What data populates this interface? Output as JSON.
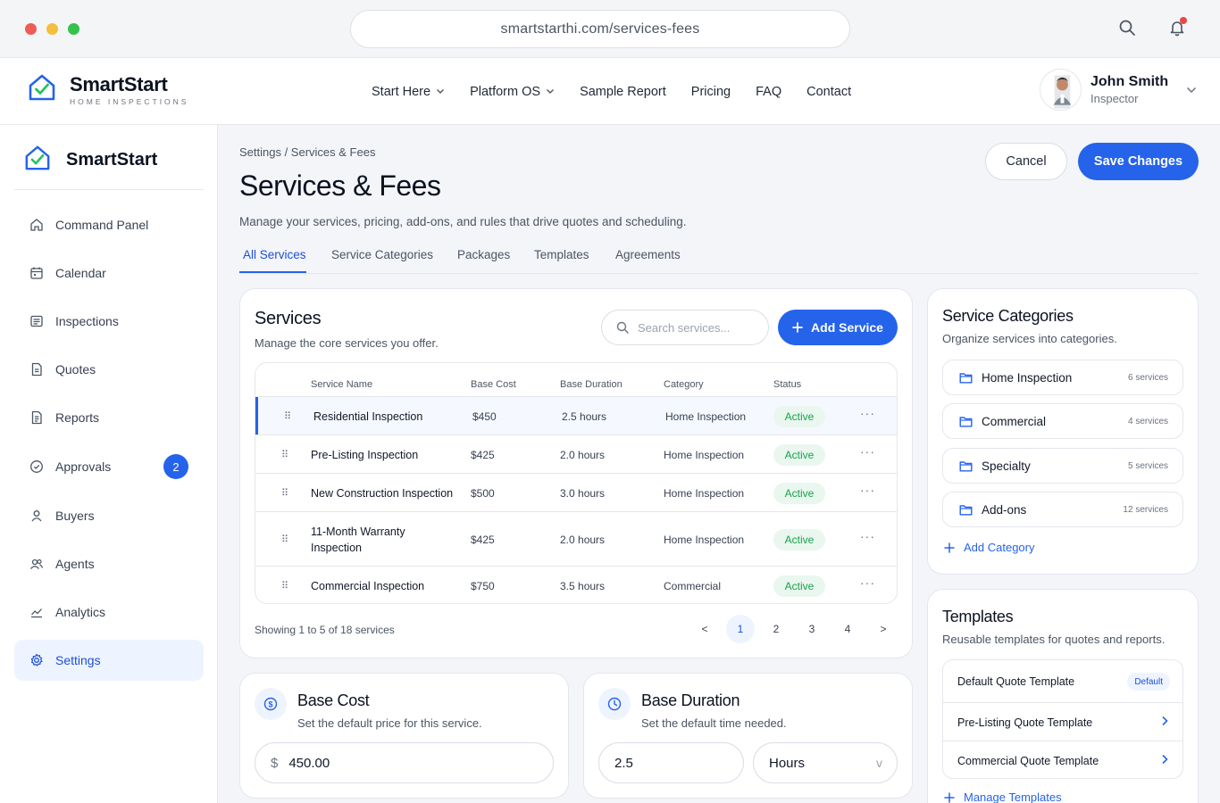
{
  "browser": {
    "url": "smartstarthi.com/services-fees"
  },
  "topnav": {
    "brand_name": "SmartStart",
    "brand_sub": "HOME INSPECTIONS",
    "links": [
      {
        "label": "Start Here",
        "dropdown": true
      },
      {
        "label": "Platform OS",
        "dropdown": true
      },
      {
        "label": "Sample Report",
        "dropdown": false
      },
      {
        "label": "Pricing",
        "dropdown": false
      },
      {
        "label": "FAQ",
        "dropdown": false
      },
      {
        "label": "Contact",
        "dropdown": false
      }
    ],
    "user": {
      "name": "John Smith",
      "role": "Inspector"
    }
  },
  "sidebar": {
    "brand_name": "SmartStart",
    "items": [
      {
        "label": "Command Panel",
        "icon": "home-icon"
      },
      {
        "label": "Calendar",
        "icon": "calendar-icon"
      },
      {
        "label": "Inspections",
        "icon": "list-icon"
      },
      {
        "label": "Quotes",
        "icon": "document-icon"
      },
      {
        "label": "Reports",
        "icon": "report-icon"
      },
      {
        "label": "Approvals",
        "icon": "check-circle-icon",
        "badge": "2"
      },
      {
        "label": "Buyers",
        "icon": "user-icon"
      },
      {
        "label": "Agents",
        "icon": "users-icon"
      },
      {
        "label": "Analytics",
        "icon": "chart-icon"
      },
      {
        "label": "Settings",
        "icon": "gear-icon",
        "active": true
      }
    ]
  },
  "header": {
    "breadcrumb": "Settings / Services & Fees",
    "title": "Services & Fees",
    "description": "Manage your services, pricing, add-ons, and rules that drive quotes and scheduling.",
    "cancel_label": "Cancel",
    "save_label": "Save Changes",
    "tabs": [
      "All Services",
      "Service Categories",
      "Packages",
      "Templates",
      "Agreements"
    ],
    "active_tab": "All Services"
  },
  "services": {
    "title": "Services",
    "subtitle": "Manage the core services you offer.",
    "search_placeholder": "Search services...",
    "add_label": "Add Service",
    "columns": [
      "Service Name",
      "Base Cost",
      "Base Duration",
      "Category",
      "Status"
    ],
    "rows": [
      {
        "name": "Residential Inspection",
        "cost": "$450",
        "duration": "2.5 hours",
        "category": "Home Inspection",
        "status": "Active",
        "selected": true
      },
      {
        "name": "Pre-Listing Inspection",
        "cost": "$425",
        "duration": "2.0 hours",
        "category": "Home Inspection",
        "status": "Active"
      },
      {
        "name": "New Construction Inspection",
        "cost": "$500",
        "duration": "3.0 hours",
        "category": "Home Inspection",
        "status": "Active"
      },
      {
        "name": "11-Month Warranty Inspection",
        "cost": "$425",
        "duration": "2.0 hours",
        "category": "Home Inspection",
        "status": "Active"
      },
      {
        "name": "Commercial Inspection",
        "cost": "$750",
        "duration": "3.5 hours",
        "category": "Commercial",
        "status": "Active"
      }
    ],
    "showing": "Showing 1 to 5 of 18 services",
    "pagination": {
      "prev": "<",
      "pages": [
        "1",
        "2",
        "3",
        "4"
      ],
      "current": "1",
      "next": ">"
    }
  },
  "base_cost": {
    "title": "Base Cost",
    "subtitle": "Set the default price for this service.",
    "currency": "$",
    "value": "450.00"
  },
  "base_duration": {
    "title": "Base Duration",
    "subtitle": "Set the default time needed.",
    "value": "2.5",
    "unit": "Hours",
    "unit_chevron": "v"
  },
  "categories": {
    "title": "Service Categories",
    "subtitle": "Organize services into categories.",
    "items": [
      {
        "name": "Home Inspection",
        "count": "6 services"
      },
      {
        "name": "Commercial",
        "count": "4 services"
      },
      {
        "name": "Specialty",
        "count": "5 services"
      },
      {
        "name": "Add-ons",
        "count": "12 services"
      }
    ],
    "add_label": "Add Category"
  },
  "templates": {
    "title": "Templates",
    "subtitle": "Reusable templates for quotes and reports.",
    "items": [
      {
        "name": "Default Quote Template",
        "badge": "Default"
      },
      {
        "name": "Pre-Listing Quote Template"
      },
      {
        "name": "Commercial Quote Template"
      }
    ],
    "manage_label": "Manage Templates"
  },
  "colors": {
    "accent": "#2563eb",
    "active_status": "#16a34a",
    "notification": "#ef4444"
  }
}
